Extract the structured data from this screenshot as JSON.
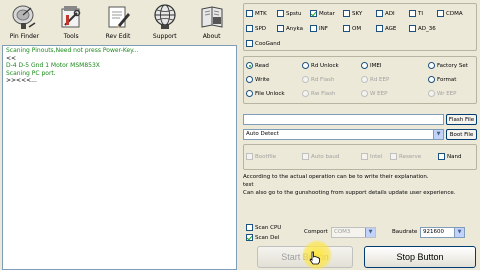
{
  "toolbar": {
    "buttons": [
      {
        "label": "Pin Finder",
        "icon": "satellite-dish-icon"
      },
      {
        "label": "Tools",
        "icon": "tools-icon"
      },
      {
        "label": "Rev Edit",
        "icon": "document-pen-icon"
      },
      {
        "label": "Support",
        "icon": "globe-icon"
      },
      {
        "label": "About",
        "icon": "about-book-icon"
      }
    ]
  },
  "log": {
    "lines": [
      {
        "text": "Scaning Pinouts,Need not press Power-Key...",
        "color": "#1a8a1a"
      },
      {
        "text": "<<",
        "color": "#000000"
      },
      {
        "text": "D-4 D-5 Gnd 1 Motor MSM853X",
        "color": "#1a8a1a"
      },
      {
        "text": "Scaning PC port.",
        "color": "#1a8a1a"
      },
      {
        "text": ">><<<...",
        "color": "#000000"
      }
    ]
  },
  "platforms": {
    "row1": [
      {
        "label": "MTK",
        "checked": false
      },
      {
        "label": "Spstu",
        "checked": false
      },
      {
        "label": "Motar",
        "checked": true
      },
      {
        "label": "SKY",
        "checked": false
      },
      {
        "label": "ADI",
        "checked": false
      },
      {
        "label": "TI",
        "checked": false
      },
      {
        "label": "CDMA",
        "checked": false
      }
    ],
    "row2": [
      {
        "label": "SPD",
        "checked": false
      },
      {
        "label": "Anyka",
        "checked": false
      },
      {
        "label": "INF",
        "checked": false
      },
      {
        "label": "OM",
        "checked": false
      },
      {
        "label": "AGE",
        "checked": false
      },
      {
        "label": "AD_36",
        "checked": false
      }
    ],
    "row3": [
      {
        "label": "CooGand",
        "checked": false
      }
    ]
  },
  "operations": [
    {
      "label": "Read",
      "selected": true,
      "enabled": true
    },
    {
      "label": "Rd Unlock",
      "selected": false,
      "enabled": true
    },
    {
      "label": "IMEI",
      "selected": false,
      "enabled": true
    },
    {
      "label": "Factory Set",
      "selected": false,
      "enabled": true
    },
    {
      "label": "Write",
      "selected": false,
      "enabled": true
    },
    {
      "label": "Rd Flash",
      "selected": false,
      "enabled": false
    },
    {
      "label": "Rd EEP",
      "selected": false,
      "enabled": false
    },
    {
      "label": "Format",
      "selected": false,
      "enabled": true
    },
    {
      "label": "File Unlock",
      "selected": false,
      "enabled": true
    },
    {
      "label": "Rw Flash",
      "selected": false,
      "enabled": false
    },
    {
      "label": "W EEP",
      "selected": false,
      "enabled": false
    },
    {
      "label": "Wr EEP",
      "selected": false,
      "enabled": false
    }
  ],
  "flash": {
    "file_value": "",
    "flash_file_label": "Flash File",
    "mode_value": "Auto Detect",
    "boot_file_label": "Boot File"
  },
  "options": [
    {
      "label": "Bootfile"
    },
    {
      "label": "Auto baud"
    },
    {
      "label": "Intel"
    },
    {
      "label": "Reserve"
    },
    {
      "label": "Nand"
    }
  ],
  "info": {
    "line1": "According to the actual operation can be to write their explanation.",
    "line2": "test",
    "line3": "Can also go to the gunshooting from support details update user experience."
  },
  "bottom": {
    "scan_cpu_label": "Scan CPU",
    "scan_cpu_checked": false,
    "scan_del_label": "Scan Del",
    "scan_del_checked": true,
    "comport_label": "Comport",
    "comport_value": "COM3",
    "baudrate_label": "Baudrate",
    "baudrate_value": "921600",
    "start_label": "Start Button",
    "stop_label": "Stop Button"
  },
  "colors": {
    "window_bg": "#ece9d8",
    "log_green": "#1a8a1a",
    "check_green": "#21a121",
    "border_blue": "#003c74"
  }
}
